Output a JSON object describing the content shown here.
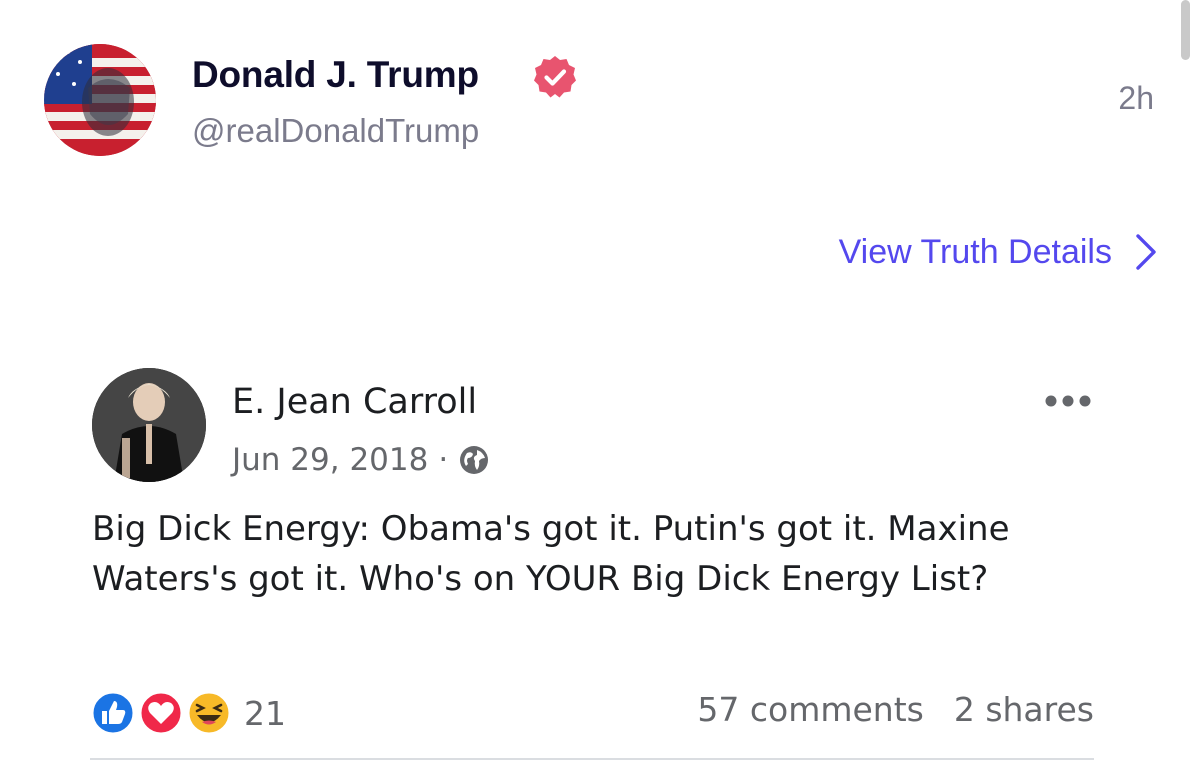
{
  "post": {
    "display_name": "Donald J. Trump",
    "handle": "@realDonaldTrump",
    "timestamp": "2h",
    "view_details_label": "View Truth Details",
    "verified_color": "#e8546f",
    "accent_color": "#5448ee"
  },
  "embedded": {
    "author": "E. Jean Carroll",
    "date": "Jun 29, 2018",
    "separator": "·",
    "privacy_icon": "globe-icon",
    "text": "Big Dick Energy: Obama's got it. Putin's got it. Maxine Waters's got it. Who's on YOUR Big Dick Energy List?",
    "reactions": {
      "icons": [
        "like-icon",
        "love-icon",
        "haha-icon"
      ],
      "count": "21"
    },
    "comments": "57 comments",
    "shares": "2 shares"
  }
}
